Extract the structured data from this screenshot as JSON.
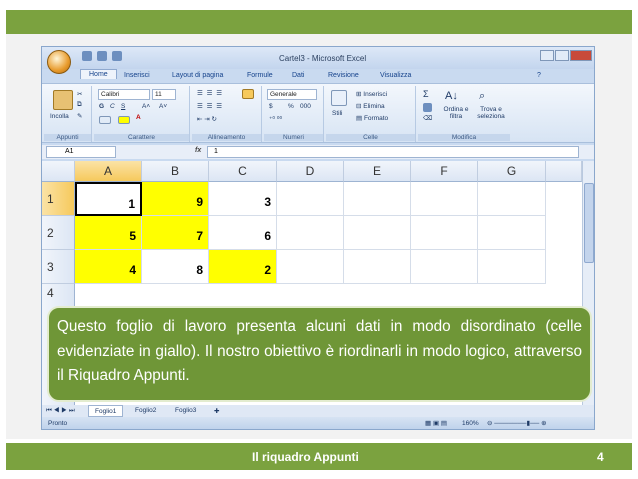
{
  "window": {
    "title": "Cartel3 - Microsoft Excel"
  },
  "tabs": [
    "Home",
    "Inserisci",
    "Layout di pagina",
    "Formule",
    "Dati",
    "Revisione",
    "Visualizza"
  ],
  "ribbon": {
    "groups": [
      "Appunti",
      "Carattere",
      "Allineamento",
      "Numeri",
      "Celle",
      "Modifica"
    ],
    "paste_label": "Incolla",
    "font_name": "Calibri",
    "font_size": "11",
    "bold": "G",
    "italic": "C",
    "underline": "S",
    "number_format": "Generale",
    "percent": "%",
    "thousands": "000",
    "styles_label": "Stili",
    "insert_label": "Inserisci",
    "delete_label": "Elimina",
    "format_label": "Formato",
    "sort_label": "Ordina e filtra",
    "find_label": "Trova e seleziona",
    "sigma": "Σ"
  },
  "formula": {
    "cell_ref": "A1",
    "fx": "fx",
    "value": "1"
  },
  "columns": [
    "A",
    "B",
    "C",
    "D",
    "E",
    "F",
    "G"
  ],
  "rows": [
    "1",
    "2",
    "3",
    "4"
  ],
  "cells": {
    "r1": [
      "1",
      "9",
      "3"
    ],
    "r2": [
      "5",
      "7",
      "6"
    ],
    "r3": [
      "4",
      "8",
      "2"
    ]
  },
  "sheets": [
    "Foglio1",
    "Foglio2",
    "Foglio3"
  ],
  "status": {
    "text": "Pronto",
    "zoom": "160%"
  },
  "callout": {
    "text": "Questo foglio di lavoro presenta alcuni dati in modo disordinato (celle evidenziate in giallo). Il nostro obiettivo è riordinarli in modo logico, attraverso il Riquadro Appunti."
  },
  "footer": {
    "title": "Il riquadro Appunti",
    "page": "4"
  },
  "colors": {
    "accent_green": "#7ba23f",
    "callout_green": "#6f9637",
    "highlight_yellow": "#ffff00"
  }
}
